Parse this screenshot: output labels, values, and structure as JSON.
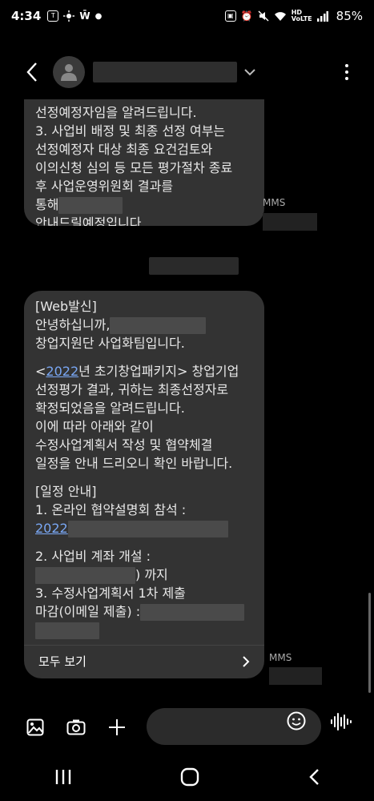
{
  "status": {
    "time": "4:34",
    "left_icons": [
      "talk-icon",
      "sun-icon",
      "w-icon",
      "dot-icon"
    ],
    "right_icons": [
      "alarm-icon",
      "mute-icon",
      "wifi-icon",
      "hd-icon",
      "signal-icon"
    ],
    "battery": "85%"
  },
  "header": {
    "back_icon": "back-arrow-icon",
    "more_icon": "more-vert-icon"
  },
  "message1": {
    "lines": [
      "선정예정자임을 알려드립니다.",
      "3. 사업비 배정 및 최종 선정 여부는",
      "선정예정자 대상 최종 요건검토와",
      "이의신청 심의 등 모든 평가절차 종료",
      "후 사업운영위원회 결과를",
      "통해",
      "안내드릴예정입니다."
    ],
    "tag": "MMS"
  },
  "message2": {
    "line1": "[Web발신]",
    "line2": "안녕하십니까,",
    "line3": "창업지원단 사업화팀입니다.",
    "line4_pre": "<",
    "line4_link": "2022",
    "line4_post": "년 초기창업패키지> 창업기업",
    "line5": "선정평가 결과, 귀하는 최종선정자로",
    "line6": "확정되었음을 알려드립니다.",
    "line7": "이에 따라 아래와 같이",
    "line8": "수정사업계획서 작성 및 협약체결",
    "line9": "일정을 안내 드리오니 확인 바랍니다.",
    "line10": "[일정 안내]",
    "line11": "1. 온라인 협약설명회 참석 :",
    "line12": "2022",
    "line13": "2. 사업비 계좌 개설 :",
    "line14_post": ") 까지",
    "line15": "3. 수정사업계획서 1차 제출",
    "line16": "마감(이메일 제출) :",
    "see_all": "모두 보기",
    "tag": "MMS"
  },
  "composer": {
    "gallery_icon": "gallery-icon",
    "camera_icon": "camera-icon",
    "add_icon": "plus-icon",
    "emoji_icon": "emoji-icon",
    "voice_icon": "voice-icon"
  },
  "nav": {
    "recent_icon": "recent-apps-icon",
    "home_icon": "home-icon",
    "back_icon": "nav-back-icon"
  }
}
